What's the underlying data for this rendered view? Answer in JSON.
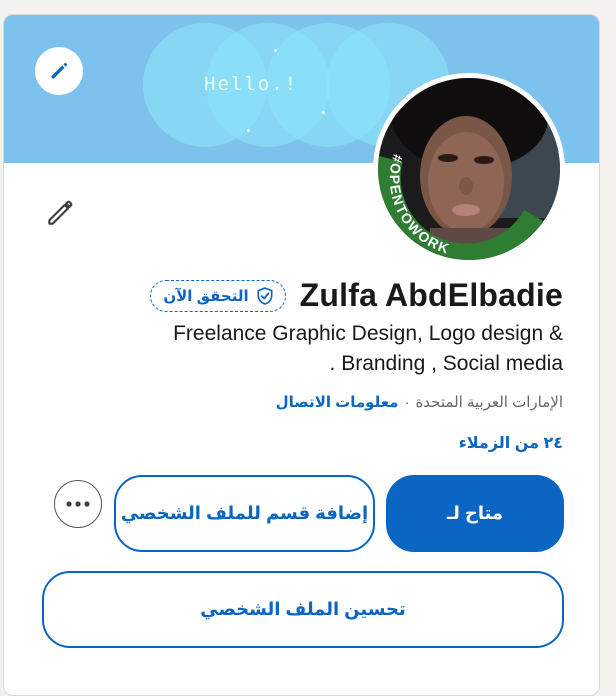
{
  "banner": {
    "greeting": "Hello.!",
    "edit_icon": "pencil-icon",
    "color": "#7cc2ec"
  },
  "avatar": {
    "frame_text": "#OPENTOWORK",
    "frame_color": "#2e7d32"
  },
  "profile": {
    "edit_icon": "pencil-icon",
    "name": "Zulfa AbdElbadie",
    "verify_label": "التحقق الآن",
    "headline_line1": "Freelance Graphic Design, Logo design &",
    "headline_line2": ". Branding , Social media",
    "location": "الإمارات العربية المتحدة",
    "contact_label": "معلومات الاتصال",
    "connections": "٢٤ من الزملاء"
  },
  "actions": {
    "available_label": "متاح لـ",
    "add_section_label": "إضافة قسم للملف الشخصي",
    "more_icon": "more-icon",
    "enhance_label": "تحسين الملف الشخصي"
  },
  "colors": {
    "accent": "#0a66c2",
    "text": "#191919",
    "muted": "#666666"
  }
}
